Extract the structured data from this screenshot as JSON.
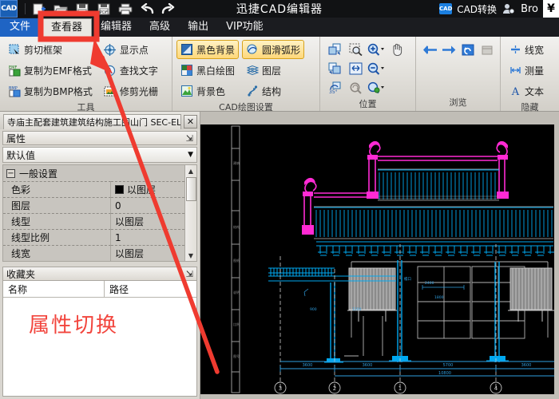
{
  "titlebar": {
    "app_logo": "CAD",
    "title": "迅捷CAD编辑器",
    "convert_icon_label": "CAD",
    "convert_label": "CAD转换",
    "user_name": "Bro",
    "currency_label": "¥",
    "quick_access": [
      {
        "name": "new-file-icon",
        "tip": "新建"
      },
      {
        "name": "open-file-icon",
        "tip": "打开"
      },
      {
        "name": "save-icon",
        "tip": "保存"
      },
      {
        "name": "save-pdf-icon",
        "tip": "另存为PDF"
      },
      {
        "name": "print-icon",
        "tip": "打印"
      },
      {
        "name": "undo-icon",
        "tip": "撤销"
      },
      {
        "name": "redo-icon",
        "tip": "重做"
      }
    ]
  },
  "menu": {
    "tabs": [
      {
        "label": "文件",
        "style": "file"
      },
      {
        "label": "查看器",
        "style": "active"
      },
      {
        "label": "编辑器",
        "style": "normal"
      },
      {
        "label": "高级",
        "style": "normal"
      },
      {
        "label": "输出",
        "style": "normal"
      },
      {
        "label": "VIP功能",
        "style": "normal"
      }
    ]
  },
  "ribbon": {
    "groups": [
      {
        "title": "工具",
        "col1": [
          {
            "label": "剪切框架",
            "icon": "cut-frame-icon"
          },
          {
            "label": "复制为EMF格式",
            "icon": "copy-emf-icon"
          },
          {
            "label": "复制为BMP格式",
            "icon": "copy-bmp-icon"
          }
        ],
        "col2": [
          {
            "label": "显示点",
            "icon": "show-points-icon"
          },
          {
            "label": "查找文字",
            "icon": "find-text-icon"
          },
          {
            "label": "修剪光栅",
            "icon": "trim-raster-icon"
          }
        ]
      },
      {
        "title": "CAD绘图设置",
        "col1": [
          {
            "label": "黑色背景",
            "icon": "black-background-icon",
            "highlighted": true
          },
          {
            "label": "黑白绘图",
            "icon": "bw-drawing-icon"
          },
          {
            "label": "背景色",
            "icon": "background-color-icon"
          }
        ],
        "col2": [
          {
            "label": "圆滑弧形",
            "icon": "smooth-arc-icon",
            "highlighted": true
          },
          {
            "label": "图层",
            "icon": "layers-icon"
          },
          {
            "label": "结构",
            "icon": "structure-icon"
          }
        ]
      },
      {
        "title": "位置",
        "icons": [
          "copy-position-icon",
          "zoom-window-icon",
          "zoom-in-icon",
          "pan-hand-icon",
          "paste-position-icon",
          "zoom-extents-icon",
          "zoom-out-icon",
          "spacer",
          "rotate-35-icon",
          "zoom-previous-icon",
          "zoom-realtime-icon",
          "spacer"
        ]
      },
      {
        "title": "浏览",
        "icons": [
          "back-arrow-icon",
          "forward-arrow-icon",
          "refresh-icon",
          "window-icon"
        ]
      },
      {
        "title": "隐藏",
        "items": [
          {
            "label": "线宽",
            "icon": "line-width-icon"
          },
          {
            "label": "测量",
            "icon": "measure-icon"
          },
          {
            "label": "文本",
            "icon": "text-icon"
          }
        ]
      }
    ]
  },
  "document": {
    "tab_title": "寺庙主配套建筑建筑结构施工图山门 SEC-ELE.png",
    "close_label": "✕"
  },
  "properties": {
    "panel_title": "属性",
    "pin_glyph": "⇲",
    "selector_value": "默认值",
    "dropdown_glyph": "▼",
    "group_label": "一般设置",
    "group_expander": "−",
    "rows": [
      {
        "name": "色彩",
        "value": "以图层",
        "swatch": "#000000"
      },
      {
        "name": "图层",
        "value": "0"
      },
      {
        "name": "线型",
        "value": "以图层"
      },
      {
        "name": "线型比例",
        "value": "1"
      },
      {
        "name": "线宽",
        "value": "以图层"
      }
    ]
  },
  "favorites": {
    "panel_title": "收藏夹",
    "pin_glyph": "⇲",
    "columns": [
      "名称",
      "路径"
    ],
    "rows": []
  },
  "annotations": {
    "callout_text": "属性切换",
    "callout_color": "#f2453d",
    "highlight_target": "查看器",
    "arrow_color": "#ef3b30"
  },
  "canvas": {
    "background": "#000000",
    "colors": {
      "magenta": "#ff2ad4",
      "cyan": "#00a8f0",
      "white": "#c9c9c9",
      "gray": "#8a8a8a"
    }
  }
}
